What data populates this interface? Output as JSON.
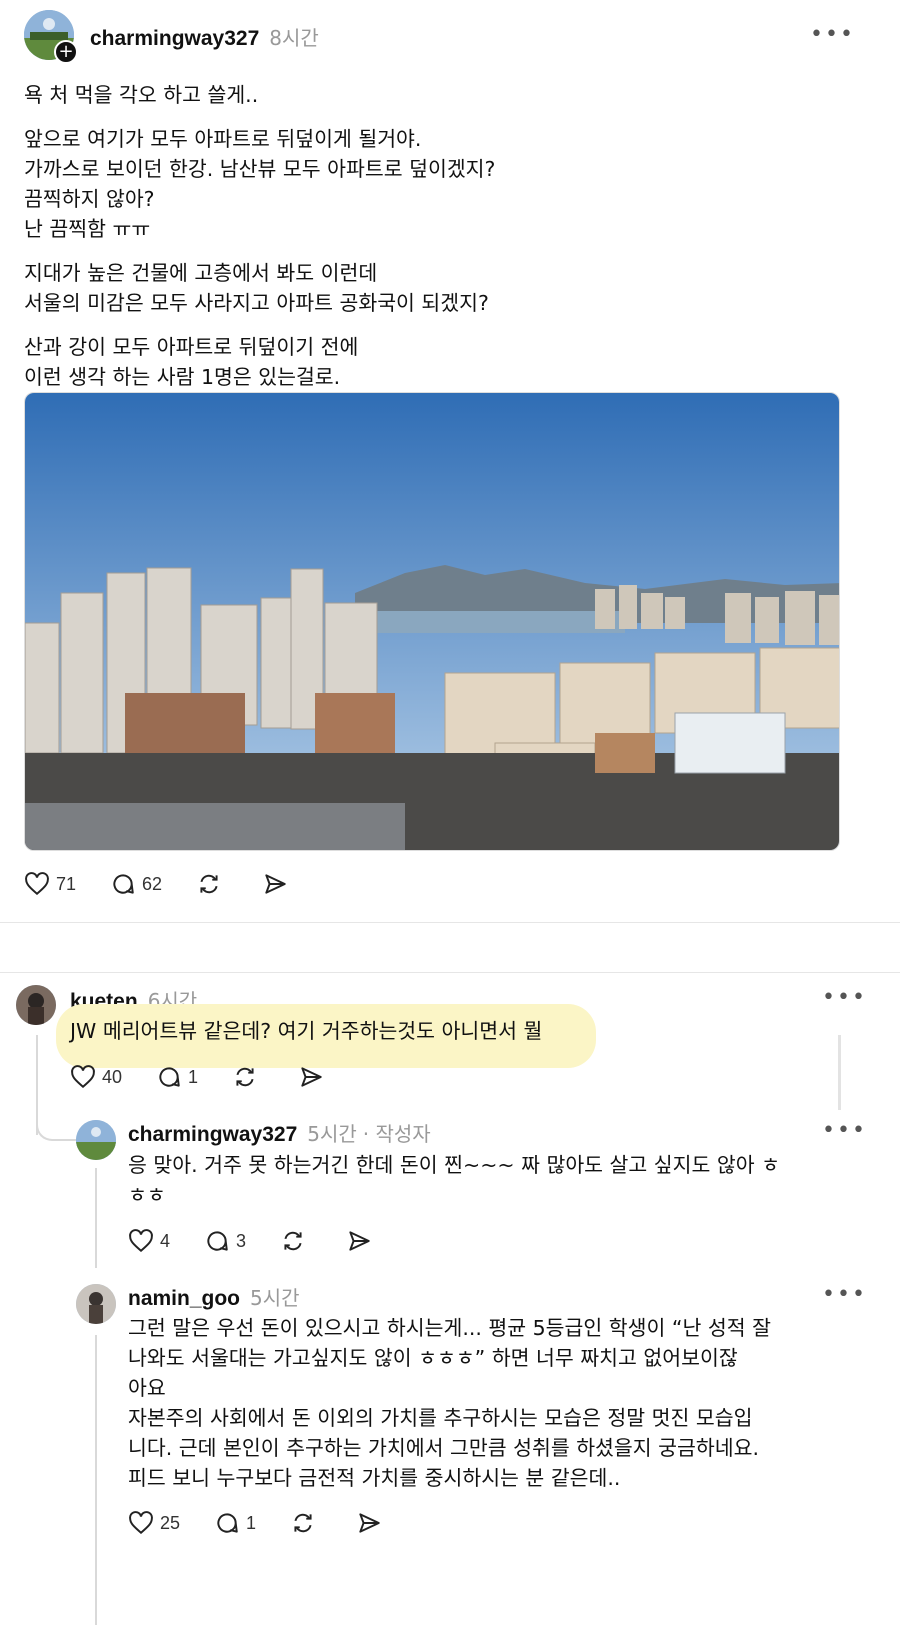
{
  "post": {
    "username": "charmingway327",
    "time": "8시간",
    "more_label": "•••",
    "paragraphs": [
      "욕 처 먹을 각오 하고 쓸게..",
      "앞으로 여기가 모두 아파트로 뒤덮이게 될거야.\n가까스로 보이던 한강. 남산뷰 모두 아파트로 덮이겠지?\n끔찍하지 않아?\n난 끔찍함 ㅠㅠ",
      "지대가 높은 건물에 고층에서 봐도 이런데\n서울의 미감은 모두 사라지고 아파트 공화국이 되겠지?",
      "산과 강이 모두 아파트로 뒤덮이기 전에\n이런 생각 하는 사람 1명은 있는걸로."
    ],
    "likes": "71",
    "replies": "62"
  },
  "comments": [
    {
      "username": "kueten",
      "time": "6시간",
      "text": "JW 메리어트뷰 같은데? 여기 거주하는것도 아니면서 뭘",
      "likes": "40",
      "replies": "1"
    },
    {
      "username": "charmingway327",
      "time": "5시간",
      "author_tag": "· 작성자",
      "text": "응 맞아. 거주 못 하는거긴 한데 돈이 찐~~~ 짜 많아도 살고 싶지도 않아 ㅎ\nㅎㅎ",
      "likes": "4",
      "replies": "3"
    },
    {
      "username": "namin_goo",
      "time": "5시간",
      "text": "그런 말은 우선 돈이 있으시고 하시는게... 평균 5등급인 학생이 “난 성적 잘\n나와도 서울대는 가고싶지도 않이 ㅎㅎㅎ” 하면 너무 짜치고 없어보이잖\n아요\n자본주의 사회에서 돈 이외의 가치를 추구하시는 모습은 정말 멋진 모습입\n니다. 근데 본인이 추구하는 가치에서 그만큼 성취를 하셨을지 궁금하네요.\n피드 보니 누구보다 금전적 가치를 중시하시는 분 같은데..",
      "likes": "25",
      "replies": "1"
    }
  ],
  "colors": {
    "sky_top": "#2f6db5",
    "sky_bottom": "#b9d2ea",
    "highlight": "#fbf5c6",
    "muted": "#999999"
  },
  "icons": [
    "heart-icon",
    "comment-icon",
    "repost-icon",
    "share-icon",
    "follow-plus-icon",
    "more-icon"
  ]
}
